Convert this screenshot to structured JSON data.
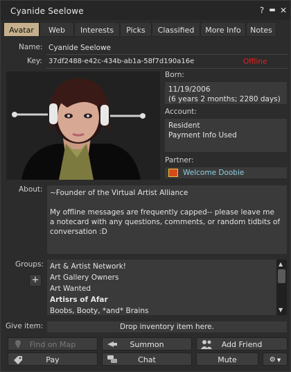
{
  "window": {
    "title": "Cyanide Seelowe"
  },
  "tabs": [
    "Avatar",
    "Web",
    "Interests",
    "Picks",
    "Classified",
    "More Info",
    "Notes"
  ],
  "profile": {
    "name_label": "Name:",
    "name": "Cyanide Seelowe",
    "key_label": "Key:",
    "key": "37df2488-e42c-434b-ab1a-58f7d190a16e",
    "status": "Offline",
    "born_label": "Born:",
    "born_date": "11/19/2006",
    "born_age": "(6 years 2 months; 2280 days)",
    "account_label": "Account:",
    "account_type": "Resident",
    "payment": "Payment Info Used",
    "partner_label": "Partner:",
    "partner": "Welcome Doobie",
    "about_label": "About:",
    "about_line1": "~Founder of the Virtual Artist Alliance",
    "about_line2": "My offline messages are frequently capped-- please leave me",
    "about_line3": "a notecard with any questions, comments, or random tidbits of",
    "about_line4": "conversation :D",
    "groups_label": "Groups:",
    "groups": [
      "Art & Artist Network!",
      "Art Gallery Owners",
      "Art Wanted",
      "Artisrs of Afar",
      "Boobs, Booty, *and* Brains"
    ],
    "give_label": "Give item:",
    "drop_text": "Drop inventory item here."
  },
  "buttons": {
    "find_on_map": "Find on Map",
    "summon": "Summon",
    "add_friend": "Add Friend",
    "pay": "Pay",
    "chat": "Chat",
    "mute": "Mute"
  },
  "colors": {
    "offline": "#e02020",
    "active_tab": "#c6b08b",
    "link": "#8fd0e0"
  }
}
